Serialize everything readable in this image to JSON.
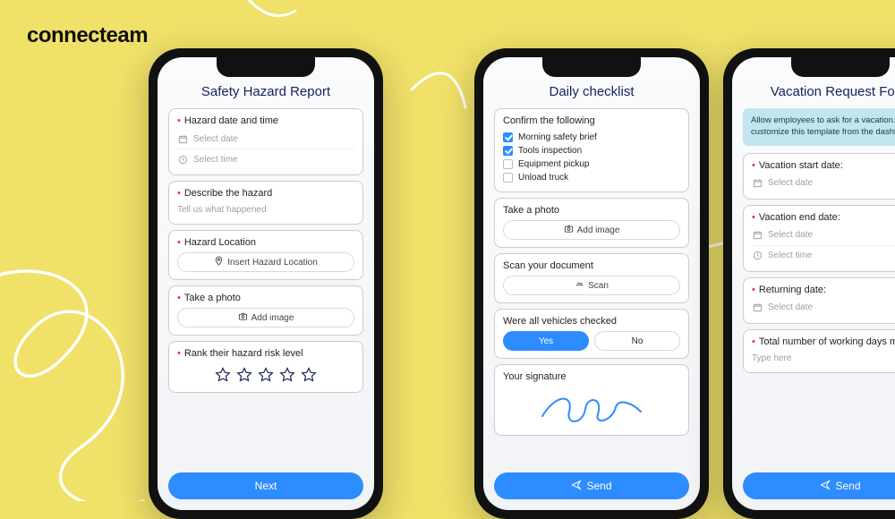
{
  "logo": "connecteam",
  "phone1": {
    "title": "Safety Hazard Report",
    "f1": {
      "label": "Hazard date and time",
      "date_ph": "Select date",
      "time_ph": "Select time"
    },
    "f2": {
      "label": "Describe the hazard",
      "ph": "Tell us what happened"
    },
    "f3": {
      "label": "Hazard Location",
      "ph": "Insert Hazard Location"
    },
    "f4": {
      "label": "Take a photo",
      "btn": "Add image"
    },
    "f5": {
      "label": "Rank their hazard risk level"
    },
    "next": "Next"
  },
  "phone2": {
    "title": "Daily checklist",
    "c1": {
      "label": "Confirm the following",
      "items": [
        {
          "label": "Morning safety brief",
          "checked": true
        },
        {
          "label": "Tools inspection",
          "checked": true
        },
        {
          "label": "Equipment pickup",
          "checked": false
        },
        {
          "label": "Unload truck",
          "checked": false
        }
      ]
    },
    "c2": {
      "label": "Take a photo",
      "btn": "Add image"
    },
    "c3": {
      "label": "Scan your document",
      "btn": "Scan"
    },
    "c4": {
      "label": "Were all vehicles checked",
      "yes": "Yes",
      "no": "No"
    },
    "c5": {
      "label": "Your signature"
    },
    "send": "Send"
  },
  "phone3": {
    "title": "Vacation Request Form",
    "info": "Allow employees to ask for a vacation. You can customize this template from the dashboard",
    "v1": {
      "label": "Vacation start date:",
      "ph": "Select date"
    },
    "v2": {
      "label": "Vacation end date:",
      "date_ph": "Select date",
      "time_ph": "Select time"
    },
    "v3": {
      "label": "Returning date:",
      "ph": "Select date"
    },
    "v4": {
      "label": "Total number of working days missed:",
      "ph": "Type here"
    },
    "send": "Send"
  }
}
